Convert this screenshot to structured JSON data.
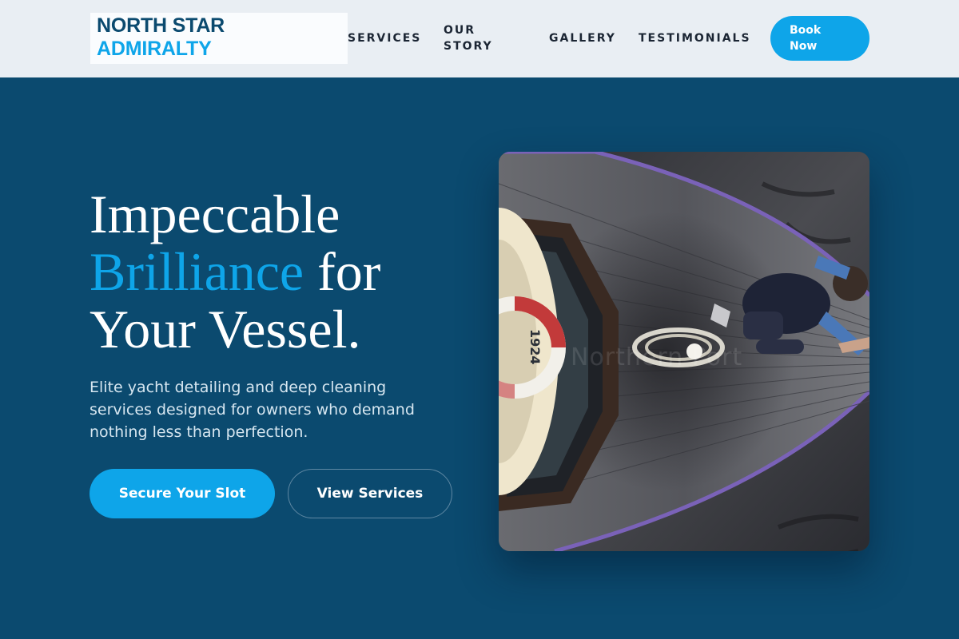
{
  "brand": {
    "line1": "NORTH STAR",
    "line2": "ADMIRALTY"
  },
  "nav": {
    "services": "SERVICES",
    "our_story": "OUR STORY",
    "gallery": "GALLERY",
    "testimonials": "TESTIMONIALS",
    "cta": "Book Now"
  },
  "hero": {
    "title_line1": "Impeccable",
    "title_accent": "Brilliance",
    "title_mid": " for",
    "title_line3": "Your Vessel.",
    "subtitle": "Elite yacht detailing and deep cleaning services designed for owners who demand nothing less than perfection.",
    "primary_button": "Secure Your Slot",
    "secondary_button": "View Services",
    "image_watermark": "Northern Port",
    "lifebuoy_number": "1924"
  },
  "colors": {
    "header_bg": "#e9eef3",
    "hero_bg": "#0b4a6f",
    "accent": "#0ea5e9",
    "text_dark": "#1b2533",
    "white": "#ffffff"
  },
  "icons": {
    "hero_image": "boat-deck-photo"
  }
}
